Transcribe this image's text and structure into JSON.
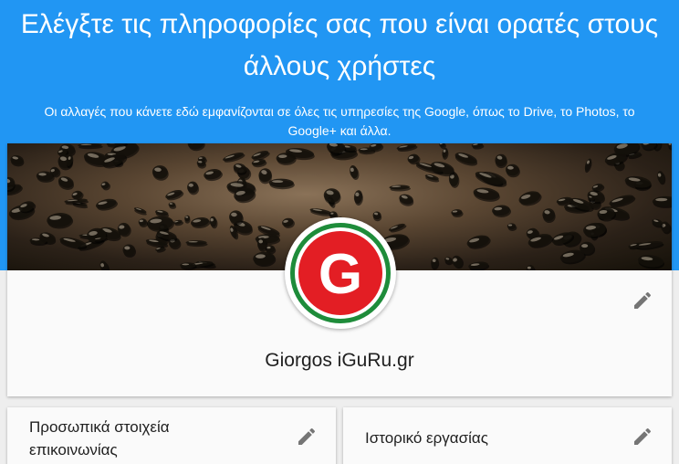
{
  "header": {
    "title": "Ελέγξτε τις πληροφορίες σας που είναι ορατές στους άλλους χρήστες",
    "subtitle": "Οι αλλαγές που κάνετε εδώ εμφανίζονται σε όλες τις υπηρεσίες της Google, όπως το Drive, το Photos, το Google+ και άλλα."
  },
  "profile": {
    "name": "Giorgos iGuRu.gr",
    "avatar_letter": "G",
    "edit_icon": "pencil-icon"
  },
  "sections": [
    {
      "title": "Προσωπικά στοιχεία επικοινωνίας",
      "edit_icon": "pencil-icon"
    },
    {
      "title": "Ιστορικό εργασίας",
      "edit_icon": "pencil-icon"
    }
  ],
  "colors": {
    "header_background": "#2196f3",
    "avatar_ring": "#1e8c3a",
    "avatar_disc": "#e31e24",
    "icon": "#757575"
  }
}
